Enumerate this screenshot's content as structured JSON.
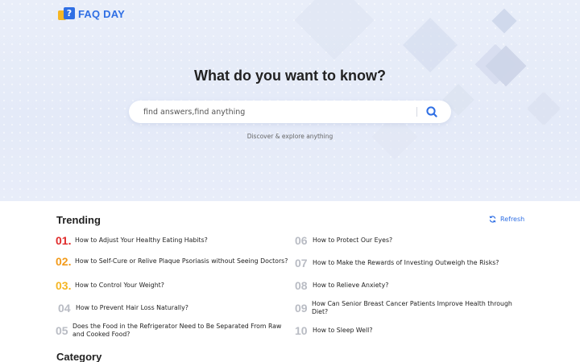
{
  "brand": {
    "logo_mark_text": "?",
    "name": "FAQ DAY"
  },
  "hero": {
    "title": "What do you want to know?",
    "search": {
      "placeholder": "find answers,find anything",
      "value": ""
    },
    "subtitle": "Discover & explore anything"
  },
  "trending": {
    "title": "Trending",
    "refresh_label": "Refresh",
    "items": [
      {
        "rank": "01.",
        "text": "How to Adjust Your Healthy Eating Habits?"
      },
      {
        "rank": "02.",
        "text": "How to Self-Cure or Relive Plaque Psoriasis without Seeing Doctors?"
      },
      {
        "rank": "03.",
        "text": "How to Control Your Weight?"
      },
      {
        "rank": "04",
        "text": "How to Prevent Hair Loss Naturally?"
      },
      {
        "rank": "05",
        "text": "Does the Food in the Refrigerator Need to Be Separated From Raw and Cooked Food?"
      },
      {
        "rank": "06",
        "text": "How to Protect Our Eyes?"
      },
      {
        "rank": "07",
        "text": "How to Make the Rewards of Investing Outweigh the Risks?"
      },
      {
        "rank": "08",
        "text": "How to Relieve Anxiety?"
      },
      {
        "rank": "09",
        "text": "How Can Senior Breast Cancer Patients Improve Health through Diet?"
      },
      {
        "rank": "10",
        "text": "How to Sleep Well?"
      }
    ]
  },
  "category": {
    "title": "Category"
  },
  "colors": {
    "accent": "#2f6fe4",
    "rank_1": "#e02b2b",
    "rank_2": "#f29a1a",
    "rank_3": "#f5b623",
    "rank_muted": "#b9bcc4"
  }
}
